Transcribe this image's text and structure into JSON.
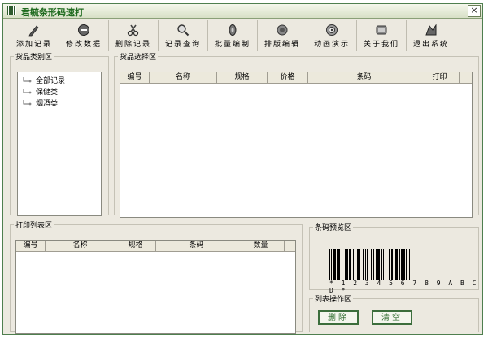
{
  "window": {
    "title": "君毓条形码速打",
    "close_glyph": "×"
  },
  "toolbar": {
    "items": [
      {
        "label": "添加记录",
        "icon": "pencil-icon"
      },
      {
        "label": "修改数据",
        "icon": "edit-disc-icon"
      },
      {
        "label": "删除记录",
        "icon": "scissors-icon"
      },
      {
        "label": "记录查询",
        "icon": "magnifier-icon"
      },
      {
        "label": "批量编制",
        "icon": "batch-icon"
      },
      {
        "label": "排版编辑",
        "icon": "layout-icon"
      },
      {
        "label": "动画演示",
        "icon": "animation-icon"
      },
      {
        "label": "关于我们",
        "icon": "about-icon"
      },
      {
        "label": "退出系统",
        "icon": "exit-icon"
      }
    ]
  },
  "category": {
    "legend": "货品类别区",
    "items": [
      "全部记录",
      "保健类",
      "烟酒类"
    ]
  },
  "goods": {
    "legend": "货品选择区",
    "columns": [
      "编号",
      "名称",
      "规格",
      "价格",
      "条码",
      "打印"
    ]
  },
  "print_list": {
    "legend": "打印列表区",
    "columns": [
      "编号",
      "名称",
      "规格",
      "条码",
      "数量"
    ]
  },
  "barcode_preview": {
    "legend": "条码预览区",
    "digits": "* 1 2 3 4 5 6 7 8 9 A B C D *"
  },
  "list_ops": {
    "legend": "列表操作区",
    "delete_label": "删除",
    "clear_label": "清空"
  },
  "colors": {
    "accent": "#2d6b2d",
    "frame": "#4f7f4f",
    "panel": "#ece9e0"
  }
}
